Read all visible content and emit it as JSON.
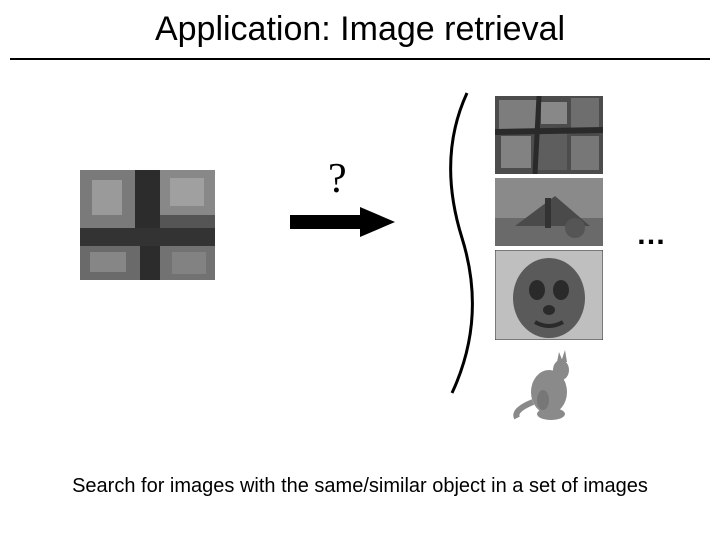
{
  "title": "Application: Image retrieval",
  "query_marker": "?",
  "ellipsis": "…",
  "caption": "Search for images with the same/similar object in a set of images",
  "images": {
    "query_alt": "aerial-intersection",
    "result1_alt": "aerial-rooftops",
    "result2_alt": "aerial-field",
    "result3_alt": "statue-face",
    "result4_alt": "kangaroo"
  }
}
